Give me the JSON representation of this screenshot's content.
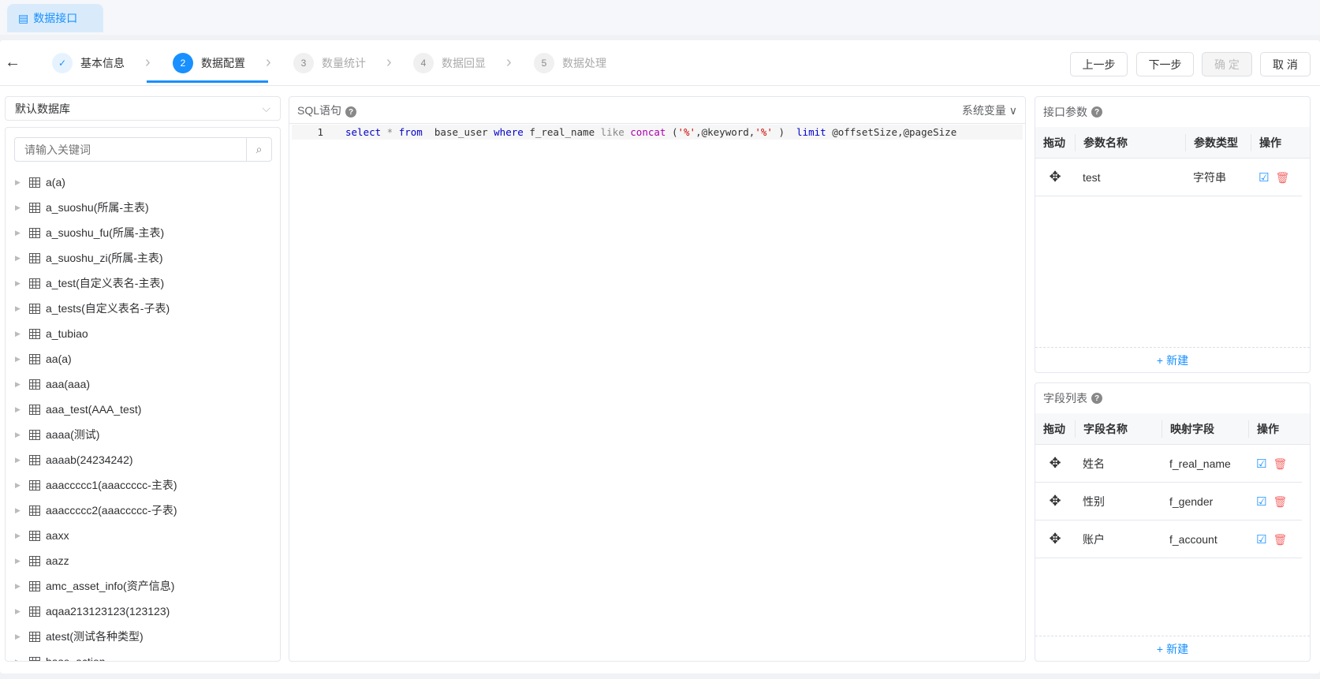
{
  "tab": {
    "label": "数据接口"
  },
  "steps": [
    {
      "num": "✓",
      "label": "基本信息"
    },
    {
      "num": "2",
      "label": "数据配置"
    },
    {
      "num": "3",
      "label": "数量统计"
    },
    {
      "num": "4",
      "label": "数据回显"
    },
    {
      "num": "5",
      "label": "数据处理"
    }
  ],
  "buttons": {
    "prev": "上一步",
    "next": "下一步",
    "confirm": "确 定",
    "cancel": "取 消"
  },
  "db_select": {
    "value": "默认数据库"
  },
  "tree_search": {
    "placeholder": "请输入关键词"
  },
  "tables": [
    "a(a)",
    "a_suoshu(所属-主表)",
    "a_suoshu_fu(所属-主表)",
    "a_suoshu_zi(所属-主表)",
    "a_test(自定义表名-主表)",
    "a_tests(自定义表名-子表)",
    "a_tubiao",
    "aa(a)",
    "aaa(aaa)",
    "aaa_test(AAA_test)",
    "aaaa(测试)",
    "aaaab(24234242)",
    "aaaccccc1(aaaccccc-主表)",
    "aaaccccc2(aaaccccc-子表)",
    "aaxx",
    "aazz",
    "amc_asset_info(资产信息)",
    "aqaa213123123(123123)",
    "atest(测试各种类型)",
    "base_action"
  ],
  "sql": {
    "title": "SQL语句",
    "sys_vars": "系统变量",
    "line_no": "1",
    "tokens": [
      [
        "kw",
        "select"
      ],
      [
        "gr",
        " * "
      ],
      [
        "kw",
        "from"
      ],
      [
        "",
        "  base_user "
      ],
      [
        "kw",
        "where"
      ],
      [
        "",
        " f_real_name "
      ],
      [
        "gr",
        "like"
      ],
      [
        "",
        " "
      ],
      [
        "fn",
        "concat"
      ],
      [
        "",
        " ("
      ],
      [
        "st",
        "'%'"
      ],
      [
        "",
        ",@keyword,"
      ],
      [
        "st",
        "'%'"
      ],
      [
        "",
        " )  "
      ],
      [
        "kw",
        "limit"
      ],
      [
        "",
        " @offsetSize,@pageSize"
      ]
    ]
  },
  "params": {
    "title": "接口参数",
    "headers": [
      "拖动",
      "参数名称",
      "参数类型",
      "操作"
    ],
    "rows": [
      {
        "name": "test",
        "type": "字符串"
      }
    ],
    "add": "新建"
  },
  "fields": {
    "title": "字段列表",
    "headers": [
      "拖动",
      "字段名称",
      "映射字段",
      "操作"
    ],
    "rows": [
      {
        "name": "姓名",
        "field": "f_real_name"
      },
      {
        "name": "性别",
        "field": "f_gender"
      },
      {
        "name": "账户",
        "field": "f_account"
      }
    ],
    "add": "新建"
  }
}
